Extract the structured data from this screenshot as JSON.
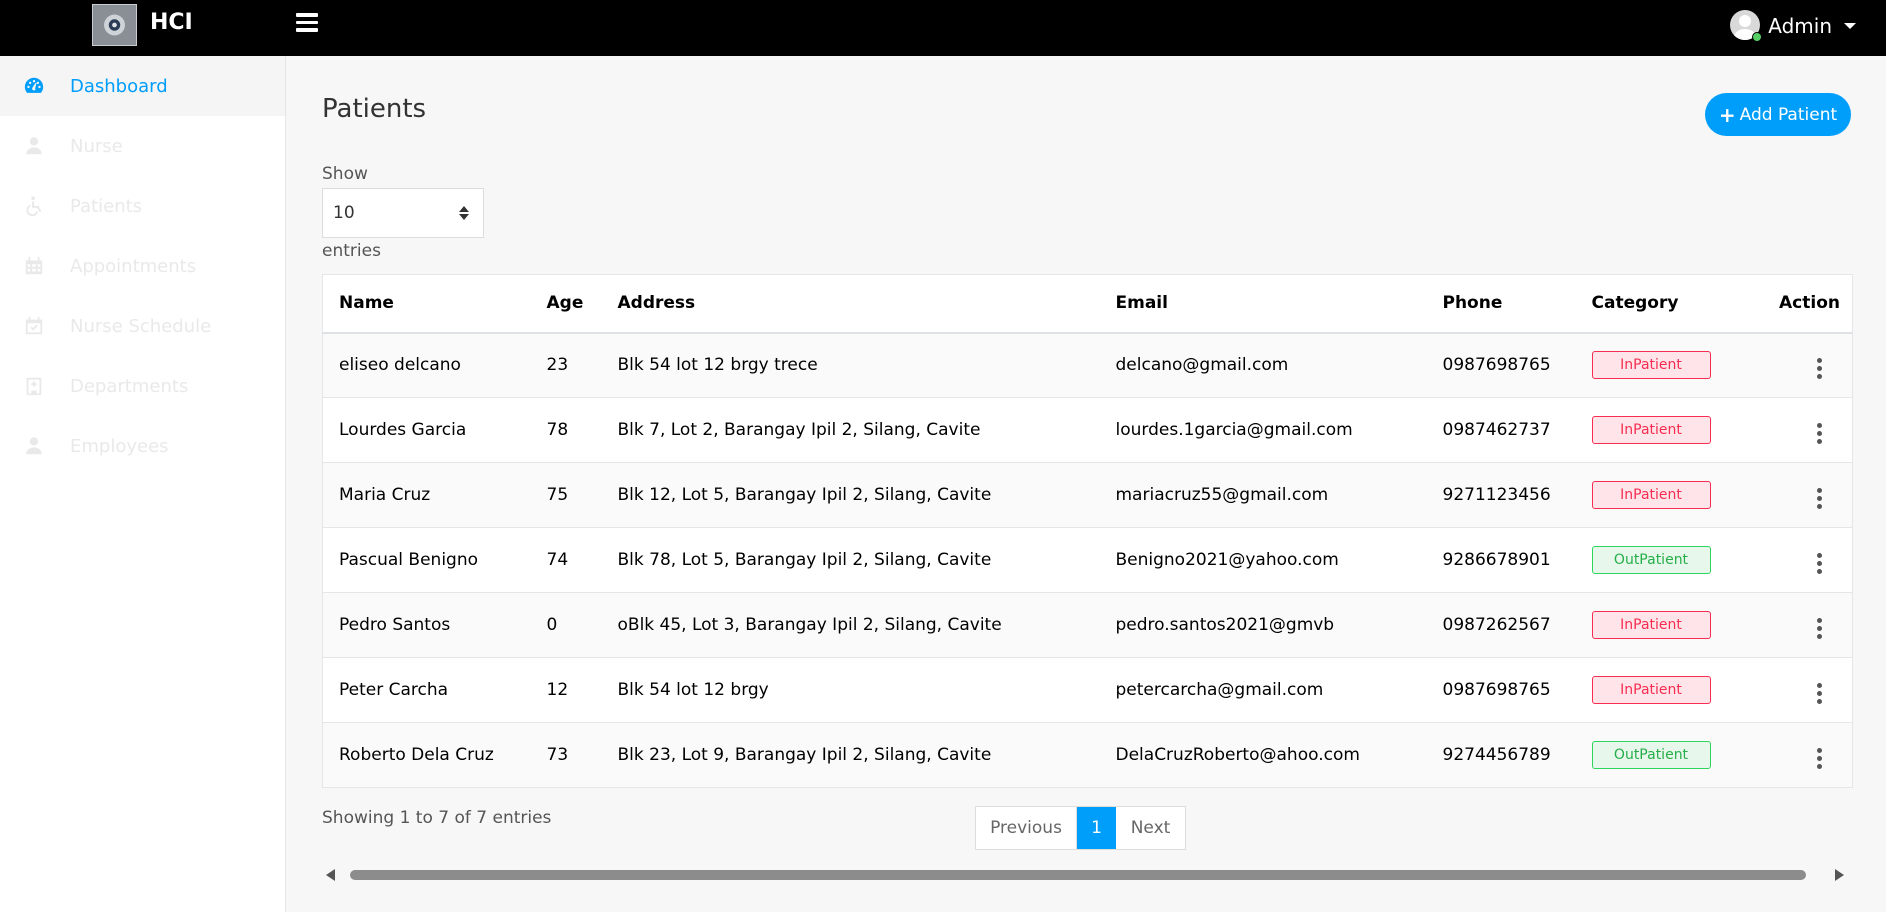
{
  "header": {
    "brand": "HCI",
    "user": "Admin"
  },
  "sidebar": {
    "items": [
      {
        "label": "Dashboard",
        "icon": "dashboard-icon"
      },
      {
        "label": "Nurse",
        "icon": "user-md-icon"
      },
      {
        "label": "Patients",
        "icon": "wheelchair-icon"
      },
      {
        "label": "Appointments",
        "icon": "calendar-icon"
      },
      {
        "label": "Nurse Schedule",
        "icon": "calendar-check-icon"
      },
      {
        "label": "Departments",
        "icon": "hospital-icon"
      },
      {
        "label": "Employees",
        "icon": "user-icon"
      }
    ]
  },
  "main": {
    "title": "Patients",
    "add_button": "Add Patient",
    "show_label": "Show",
    "entries_value": "10",
    "entries_label": "entries",
    "columns": [
      "Name",
      "Age",
      "Address",
      "Email",
      "Phone",
      "Category",
      "Action"
    ],
    "rows": [
      {
        "name": "eliseo delcano",
        "age": "23",
        "address": "Blk 54 lot 12 brgy trece",
        "email": "delcano@gmail.com",
        "phone": "0987698765",
        "category": "InPatient"
      },
      {
        "name": "Lourdes Garcia",
        "age": "78",
        "address": "Blk 7, Lot 2, Barangay Ipil 2, Silang, Cavite",
        "email": "lourdes.1garcia@gmail.com",
        "phone": "0987462737",
        "category": "InPatient"
      },
      {
        "name": "Maria Cruz",
        "age": "75",
        "address": "Blk 12, Lot 5, Barangay Ipil 2, Silang, Cavite",
        "email": "mariacruz55@gmail.com",
        "phone": "9271123456",
        "category": "InPatient"
      },
      {
        "name": "Pascual Benigno",
        "age": "74",
        "address": "Blk 78, Lot 5, Barangay Ipil 2, Silang, Cavite",
        "email": "Benigno2021@yahoo.com",
        "phone": "9286678901",
        "category": "OutPatient"
      },
      {
        "name": "Pedro Santos",
        "age": "0",
        "address": "oBlk 45, Lot 3, Barangay Ipil 2, Silang, Cavite",
        "email": "pedro.santos2021@gmvb",
        "phone": "0987262567",
        "category": "InPatient"
      },
      {
        "name": "Peter Carcha",
        "age": "12",
        "address": "Blk 54 lot 12 brgy",
        "email": "petercarcha@gmail.com",
        "phone": "0987698765",
        "category": "InPatient"
      },
      {
        "name": "Roberto Dela Cruz",
        "age": "73",
        "address": "Blk 23, Lot 9, Barangay Ipil 2, Silang, Cavite",
        "email": "DelaCruzRoberto@ahoo.com",
        "phone": "9274456789",
        "category": "OutPatient"
      }
    ],
    "showing": "Showing 1 to 7 of 7 entries",
    "pagination": {
      "previous": "Previous",
      "page": "1",
      "next": "Next"
    }
  },
  "colors": {
    "accent": "#009efb",
    "inpatient": "#f62d51",
    "outpatient": "#26af48"
  }
}
